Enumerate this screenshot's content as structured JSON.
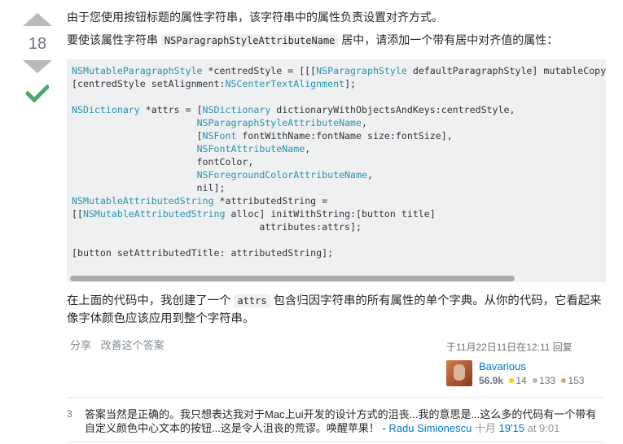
{
  "vote": {
    "count": "18"
  },
  "post": {
    "p1": "由于您使用按钮标题的属性字符串，该字符串中的属性负责设置对齐方式。",
    "p2_before": "要使该属性字符串",
    "p2_code": "NSParagraphStyleAttributeName",
    "p2_after": "居中，请添加一个带有居中对齐值的属性：",
    "p3_before": "在上面的代码中，我创建了一个",
    "p3_code": "attrs",
    "p3_after": "包含归因字符串的所有属性的单个字典。从你的代码，它看起来像字体颜色应该应用到整个字符串。"
  },
  "code": {
    "lines": [
      "NSMutableParagraphStyle *centredStyle = [[[NSParagraphStyle defaultParagraphStyle] mutableCopy] autorelease];",
      "[centredStyle setAlignment:NSCenterTextAlignment];",
      "",
      "NSDictionary *attrs = [NSDictionary dictionaryWithObjectsAndKeys:centredStyle,",
      "                      NSParagraphStyleAttributeName,",
      "                      [NSFont fontWithName:fontName size:fontSize],",
      "                      NSFontAttributeName,",
      "                      fontColor,",
      "                      NSForegroundColorAttributeName,",
      "                      nil];",
      "NSMutableAttributedString *attributedString =",
      "[[NSMutableAttributedString alloc] initWithString:[button title]",
      "                                 attributes:attrs];",
      "",
      "[button setAttributedTitle: attributedString];"
    ],
    "type_tokens": [
      "NSMutableParagraphStyle",
      "NSParagraphStyle",
      "NSCenterTextAlignment",
      "NSDictionary",
      "NSParagraphStyleAttributeName",
      "NSFont",
      "NSFontAttributeName",
      "NSForegroundColorAttributeName",
      "NSMutableAttributedString"
    ]
  },
  "menu": {
    "share": "分享",
    "improve": "改善这个答案"
  },
  "answer_meta": {
    "time": "于11月22日11日在12:11 回复",
    "user": "Bavarious",
    "reputation": "56.9k",
    "gold": "14",
    "silver": "133",
    "bronze": "153"
  },
  "comment": {
    "score": "3",
    "text": "答案当然是正确的。我只想表达我对于Mac上ui开发的设计方式的沮丧...我的意思是...这么多的代码有一个带有自定义颜色中心文本的按钮...这是令人沮丧的荒谬。唤醒苹果！ -",
    "user": "Radu Simionescu",
    "date_prefix": "十月",
    "date_link": "19'15",
    "date_suffix": "at 9:01"
  },
  "colors": {
    "vote_arrow": "#b7babd",
    "accepted": "#48a868",
    "code_type": "#2b91af",
    "link": "#0077cc",
    "gold": "#ffcc01",
    "silver": "#b4b8bc",
    "bronze": "#d1a684"
  }
}
